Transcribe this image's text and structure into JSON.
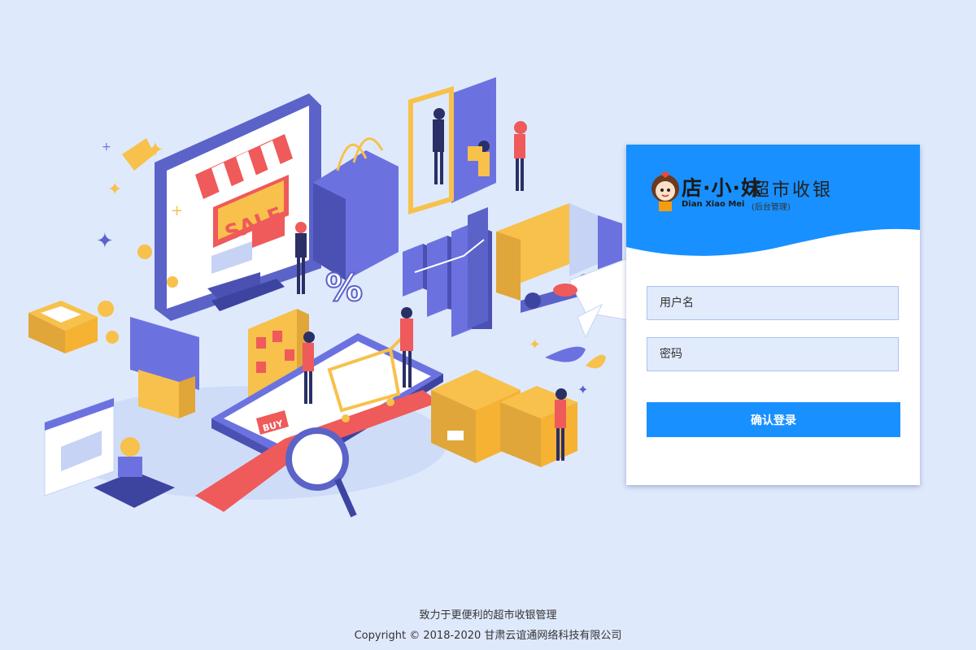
{
  "brand": {
    "logo_cn": "店·小·妹",
    "logo_en": "Dian Xiao Mei",
    "title": "超市收银",
    "subtitle": "(后台管理)"
  },
  "login": {
    "username_placeholder": "用户名",
    "password_placeholder": "密码",
    "submit_label": "确认登录"
  },
  "illustration": {
    "sale_sign": "SALE",
    "buy_tag": "BUY",
    "percent_sign": "%"
  },
  "footer": {
    "slogan": "致力于更便利的超市收银管理",
    "copyright": "Copyright © 2018-2020 甘肃云谊通网络科技有限公司"
  },
  "colors": {
    "page_bg": "#dfe9fc",
    "header_blue": "#1890ff",
    "input_bg": "#e2ebfc",
    "input_border": "#a9c3f2",
    "illustration_purple": "#5b63c9",
    "illustration_yellow": "#f7c14b",
    "illustration_red": "#ef5a5a"
  }
}
